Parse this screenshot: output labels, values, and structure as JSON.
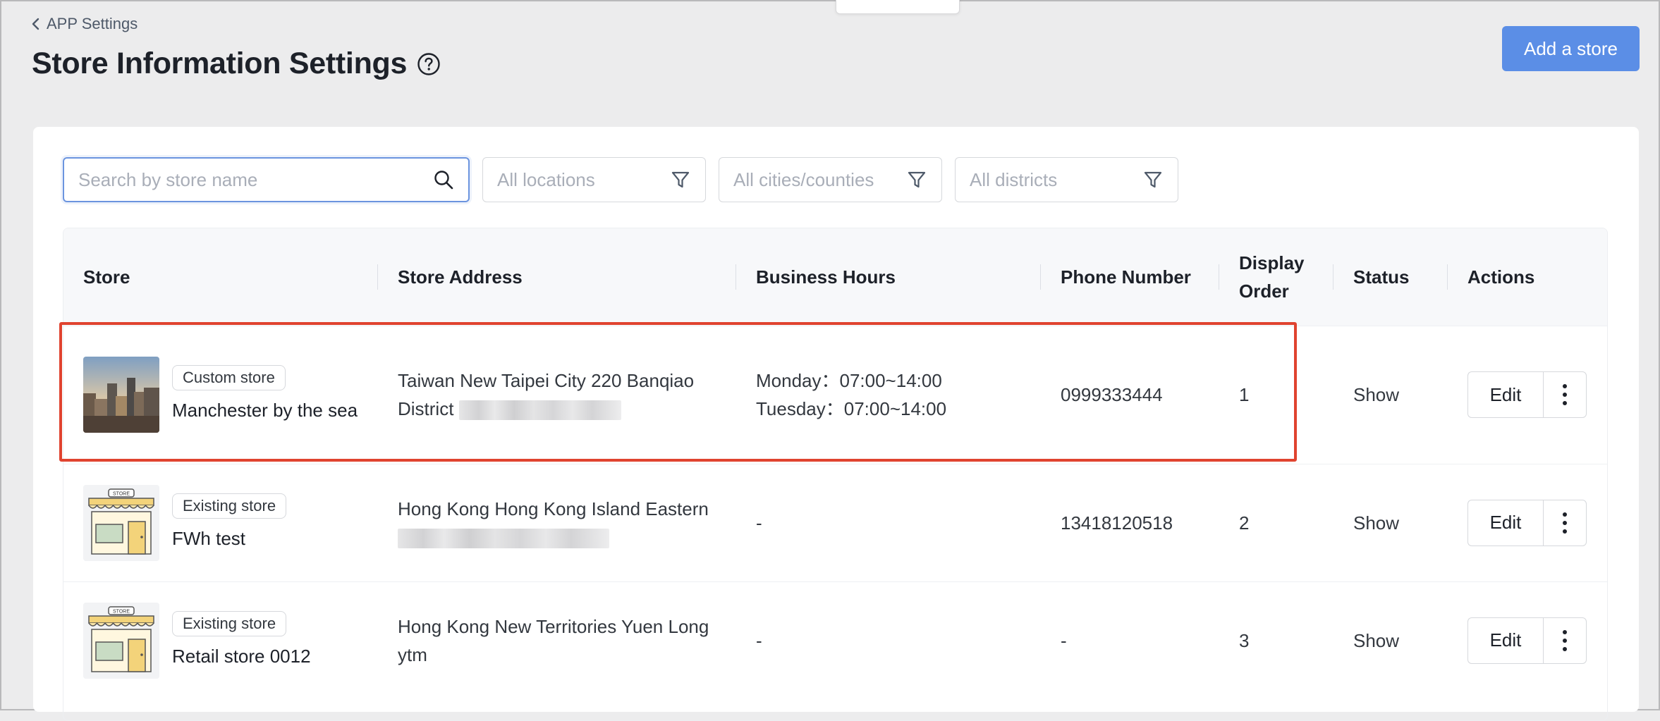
{
  "header": {
    "back_label": "APP Settings",
    "title": "Store Information Settings",
    "add_button_label": "Add a store"
  },
  "filters": {
    "search_placeholder": "Search by store name",
    "search_value": "",
    "locations": "All locations",
    "cities": "All cities/counties",
    "districts": "All districts"
  },
  "table": {
    "columns": {
      "store": "Store",
      "address": "Store Address",
      "hours": "Business Hours",
      "phone": "Phone Number",
      "order_line1": "Display",
      "order_line2": "Order",
      "status": "Status",
      "actions": "Actions"
    },
    "rows": [
      {
        "tag": "Custom store",
        "name": "Manchester by the sea",
        "address_line1": "Taiwan New Taipei City 220 Banqiao",
        "address_line2": "District",
        "hours_line1": "Monday：07:00~14:00",
        "hours_line2": "Tuesday：07:00~14:00",
        "phone": "0999333444",
        "order": "1",
        "status": "Show",
        "edit": "Edit"
      },
      {
        "tag": "Existing store",
        "name": "FWh test",
        "address_line1": "Hong Kong Hong Kong Island Eastern",
        "hours": "-",
        "phone": "13418120518",
        "order": "2",
        "status": "Show",
        "edit": "Edit"
      },
      {
        "tag": "Existing store",
        "name": "Retail store 0012",
        "address_line1": "Hong Kong New Territories Yuen Long",
        "address_line2": "ytm",
        "hours": "-",
        "phone": "-",
        "order": "3",
        "status": "Show",
        "edit": "Edit"
      }
    ]
  },
  "icons": {
    "back": "chevron-left-icon",
    "help": "question-circle-icon",
    "search": "search-icon",
    "filter": "filter-icon",
    "more": "more-vertical-icon",
    "city_photo": "city-photo-thumbnail",
    "shop": "storefront-icon"
  },
  "shop_icon_text": "STORE",
  "colors": {
    "primary_button": "#5b8ee6",
    "highlight_border": "#e0432f",
    "search_focus": "#6b94df"
  }
}
